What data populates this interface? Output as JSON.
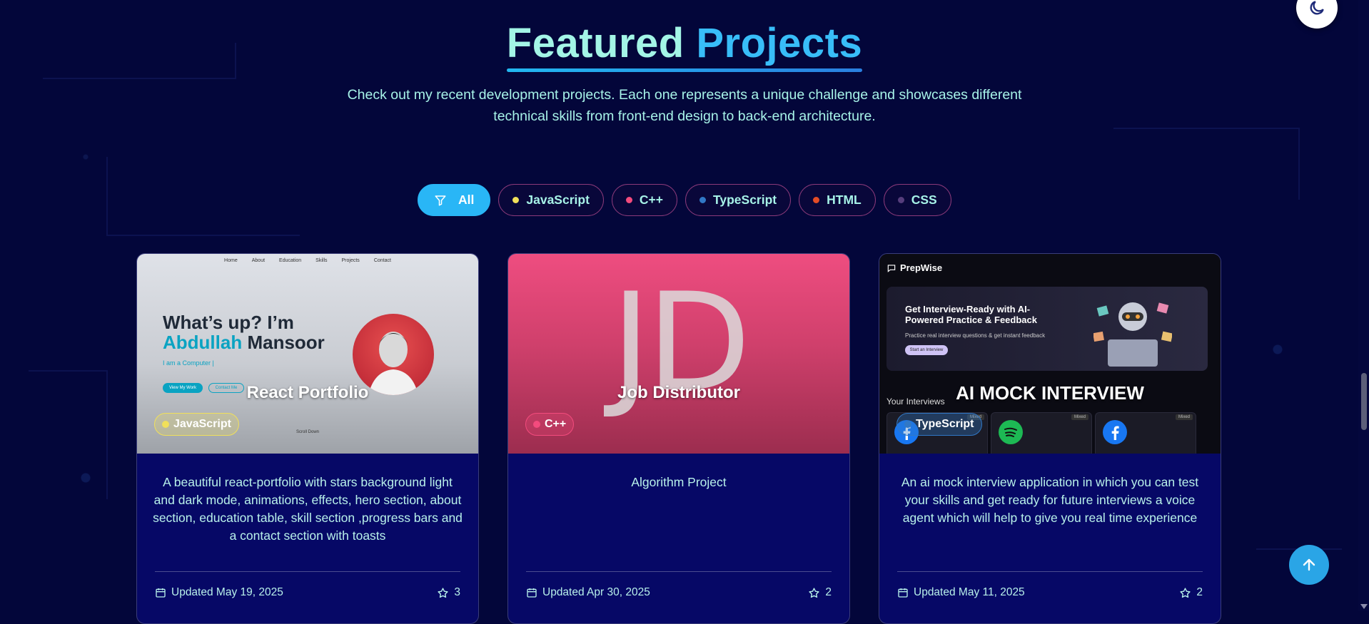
{
  "header": {
    "title_part1": "Featured",
    "title_part2": "Projects",
    "subtitle_line1": "Check out my recent development projects. Each one represents a unique challenge and showcases different",
    "subtitle_line2": "technical skills from front-end design to back-end architecture."
  },
  "filters": [
    {
      "label": "All",
      "active": true,
      "icon": "filter-icon"
    },
    {
      "label": "JavaScript",
      "color": "#f1e05a"
    },
    {
      "label": "C++",
      "color": "#f34b7d"
    },
    {
      "label": "TypeScript",
      "color": "#3178c6"
    },
    {
      "label": "HTML",
      "color": "#e34c26"
    },
    {
      "label": "CSS",
      "color": "#563d7c"
    }
  ],
  "projects": [
    {
      "title": "React Portfolio",
      "language": "JavaScript",
      "language_color": "#f1e05a",
      "description": "A beautiful react-portfolio with stars background light and dark mode, animations, effects, hero section, about section, education table, skill section ,progress bars and a contact section with toasts",
      "updated": "Updated May 19, 2025",
      "stars": "3",
      "preview": {
        "nav": [
          "Home",
          "About",
          "Education",
          "Skills",
          "Projects",
          "Contact"
        ],
        "hero_line1": "What’s up? I’m",
        "hero_first": "Abdullah",
        "hero_last": "Mansoor",
        "tagline": "I am a Computer |",
        "btn_work": "View My Work",
        "btn_contact": "Contact Me",
        "scroll": "Scroll Down"
      }
    },
    {
      "title": "Job Distributor",
      "language": "C++",
      "language_color": "#f34b7d",
      "description": "Algorithm Project",
      "updated": "Updated Apr 30, 2025",
      "stars": "2",
      "preview": {
        "initials": "JD"
      }
    },
    {
      "title": "AI MOCK INTERVIEW",
      "language": "TypeScript",
      "language_color": "#3178c6",
      "description": "An ai mock interview application in which you can test your skills and get ready for future interviews a voice agent which will help to give you real time experience",
      "updated": "Updated May 11, 2025",
      "stars": "2",
      "preview": {
        "brand": "PrepWise",
        "headline": "Get Interview-Ready with AI-Powered Practice & Feedback",
        "sub": "Practice real interview questions & get instant feedback",
        "cta": "Start an Interview",
        "your_interviews": "Your Interviews",
        "tag": "Mixed"
      }
    }
  ],
  "colors": {
    "accent": "#29b6f6",
    "background": "#03063a",
    "text": "#a7f3e8"
  }
}
